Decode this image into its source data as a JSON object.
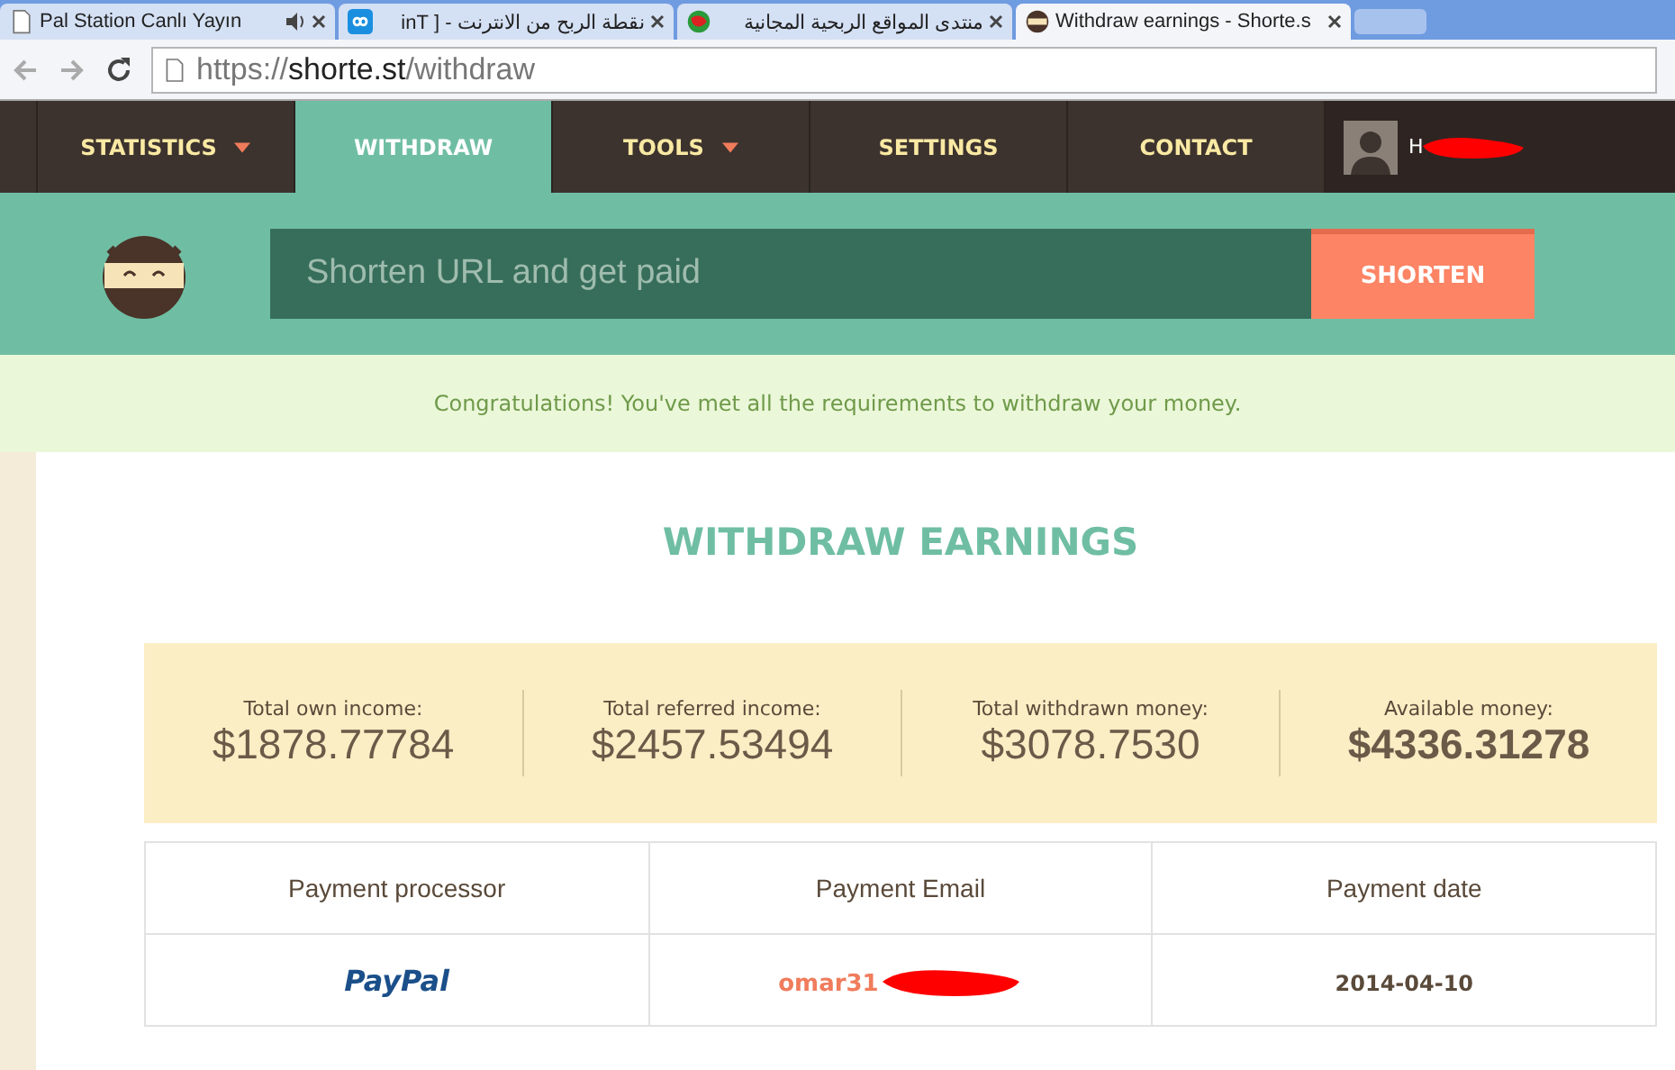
{
  "browser": {
    "tabs": [
      {
        "title": "Pal Station Canlı Yayın",
        "kind": "page",
        "audio": true,
        "selected": false
      },
      {
        "title": "نقطة الربح من الانترنت - [ inT",
        "kind": "loop",
        "audio": false,
        "selected": false
      },
      {
        "title": "منتدى المواقع الربحية المجانية",
        "kind": "globe",
        "audio": false,
        "selected": false
      },
      {
        "title": "Withdraw earnings - Shorte.s",
        "kind": "ninja",
        "audio": false,
        "selected": true
      }
    ],
    "url_host": "https://shorte.st",
    "url_path": "/withdraw"
  },
  "nav": {
    "items": [
      {
        "label": "STATISTICS",
        "dropdown": true,
        "selected": false
      },
      {
        "label": "WITHDRAW",
        "dropdown": false,
        "selected": true
      },
      {
        "label": "TOOLS",
        "dropdown": true,
        "selected": false
      },
      {
        "label": "SETTINGS",
        "dropdown": false,
        "selected": false
      },
      {
        "label": "CONTACT",
        "dropdown": false,
        "selected": false
      }
    ],
    "user_name": "H"
  },
  "shorten": {
    "placeholder": "Shorten URL and get paid",
    "button": "SHORTEN"
  },
  "notice": "Congratulations! You've met all the requirements to withdraw your money.",
  "title": "WITHDRAW EARNINGS",
  "stats": [
    {
      "label": "Total own income:",
      "value": "$1878.77784",
      "highlight": false
    },
    {
      "label": "Total referred income:",
      "value": "$2457.53494",
      "highlight": false
    },
    {
      "label": "Total withdrawn money:",
      "value": "$3078.7530",
      "highlight": false
    },
    {
      "label": "Available money:",
      "value": "$4336.31278",
      "highlight": true
    }
  ],
  "table": {
    "columns": [
      "Payment processor",
      "Payment Email",
      "Payment date"
    ],
    "rows": [
      {
        "processor": "PayPal",
        "email": "omar31",
        "date": "2014-04-10"
      }
    ]
  }
}
